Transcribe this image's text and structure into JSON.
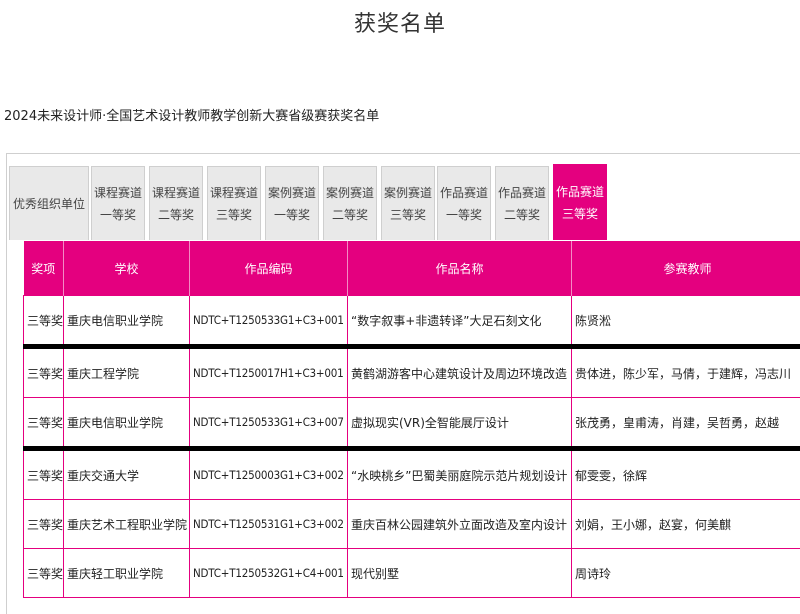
{
  "page": {
    "title": "获奖名单",
    "subtitle": "2024未来设计师·全国艺术设计教师教学创新大赛省级赛获奖名单"
  },
  "tabs": [
    {
      "line1": "优秀组织单位",
      "line2": "",
      "active": false
    },
    {
      "line1": "课程赛道",
      "line2": "一等奖",
      "active": false
    },
    {
      "line1": "课程赛道",
      "line2": "二等奖",
      "active": false
    },
    {
      "line1": "课程赛道",
      "line2": "三等奖",
      "active": false
    },
    {
      "line1": "案例赛道",
      "line2": "一等奖",
      "active": false
    },
    {
      "line1": "案例赛道",
      "line2": "二等奖",
      "active": false
    },
    {
      "line1": "案例赛道",
      "line2": "三等奖",
      "active": false
    },
    {
      "line1": "作品赛道",
      "line2": "一等奖",
      "active": false
    },
    {
      "line1": "作品赛道",
      "line2": "二等奖",
      "active": false
    },
    {
      "line1": "作品赛道",
      "line2": "三等奖",
      "active": true
    }
  ],
  "table": {
    "headers": [
      "奖项",
      "学校",
      "作品编码",
      "作品名称",
      "参赛教师"
    ],
    "rows": [
      {
        "award": "三等奖",
        "school": "重庆电信职业学院",
        "code": "NDTC+T1250533G1+C3+001",
        "name": "“数字叙事+非遗转译”大足石刻文化",
        "teachers": "陈贤淞"
      },
      {
        "award": "三等奖",
        "school": "重庆工程学院",
        "code": "NDTC+T1250017H1+C3+001",
        "name": "黄鹤湖游客中心建筑设计及周边环境改造",
        "teachers": "贵体进，陈少军，马倩，于建辉，冯志川"
      },
      {
        "award": "三等奖",
        "school": "重庆电信职业学院",
        "code": "NDTC+T1250533G1+C3+007",
        "name": "虚拟现实(VR)全智能展厅设计",
        "teachers": "张茂勇，皇甫涛，肖建，吴哲勇，赵越"
      },
      {
        "award": "三等奖",
        "school": "重庆交通大学",
        "code": "NDTC+T1250003G1+C3+002",
        "name": "“水映桃乡”巴蜀美丽庭院示范片规划设计",
        "teachers": "郁雯雯，徐辉"
      },
      {
        "award": "三等奖",
        "school": "重庆艺术工程职业学院",
        "code": "NDTC+T1250531G1+C3+002",
        "name": "重庆百林公园建筑外立面改造及室内设计",
        "teachers": "刘娟，王小娜，赵宴，何美麒"
      },
      {
        "award": "三等奖",
        "school": "重庆轻工职业学院",
        "code": "NDTC+T1250532G1+C4+001",
        "name": "现代别墅",
        "teachers": "周诗玲"
      }
    ]
  },
  "colors": {
    "accent": "#e4007f",
    "separator": "#000000"
  }
}
